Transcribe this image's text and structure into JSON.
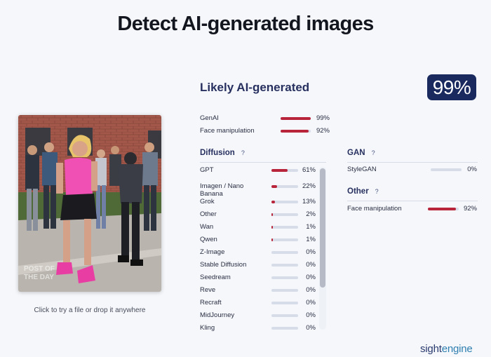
{
  "header": {
    "title": "Detect AI-generated images"
  },
  "image": {
    "caption": "POST OF THE DAY",
    "hint": "Click to try a file or drop it anywhere"
  },
  "result": {
    "verdict": "Likely AI-generated",
    "score": "99%"
  },
  "summary": [
    {
      "label": "GenAI",
      "value": 99,
      "pct": "99%"
    },
    {
      "label": "Face manipulation",
      "value": 92,
      "pct": "92%"
    }
  ],
  "diffusion": {
    "title": "Diffusion",
    "help": "?",
    "items": [
      {
        "label": "GPT",
        "value": 61,
        "pct": "61%"
      },
      {
        "label": "Imagen / Nano Banana",
        "value": 22,
        "pct": "22%"
      },
      {
        "label": "Grok",
        "value": 13,
        "pct": "13%"
      },
      {
        "label": "Other",
        "value": 2,
        "pct": "2%"
      },
      {
        "label": "Wan",
        "value": 1,
        "pct": "1%"
      },
      {
        "label": "Qwen",
        "value": 1,
        "pct": "1%"
      },
      {
        "label": "Z-Image",
        "value": 0,
        "pct": "0%"
      },
      {
        "label": "Stable Diffusion",
        "value": 0,
        "pct": "0%"
      },
      {
        "label": "Seedream",
        "value": 0,
        "pct": "0%"
      },
      {
        "label": "Reve",
        "value": 0,
        "pct": "0%"
      },
      {
        "label": "Recraft",
        "value": 0,
        "pct": "0%"
      },
      {
        "label": "MidJourney",
        "value": 0,
        "pct": "0%"
      },
      {
        "label": "Kling",
        "value": 0,
        "pct": "0%"
      }
    ]
  },
  "gan": {
    "title": "GAN",
    "help": "?",
    "items": [
      {
        "label": "StyleGAN",
        "value": 0,
        "pct": "0%"
      }
    ]
  },
  "other": {
    "title": "Other",
    "help": "?",
    "items": [
      {
        "label": "Face manipulation",
        "value": 92,
        "pct": "92%"
      }
    ]
  },
  "footer": {
    "brand_a": "sight",
    "brand_b": "engine"
  },
  "colors": {
    "accent": "#b8253b",
    "badge": "#1a2a5e",
    "track": "#d6dde9",
    "title": "#27305f"
  },
  "icons": [
    "help-icon"
  ]
}
